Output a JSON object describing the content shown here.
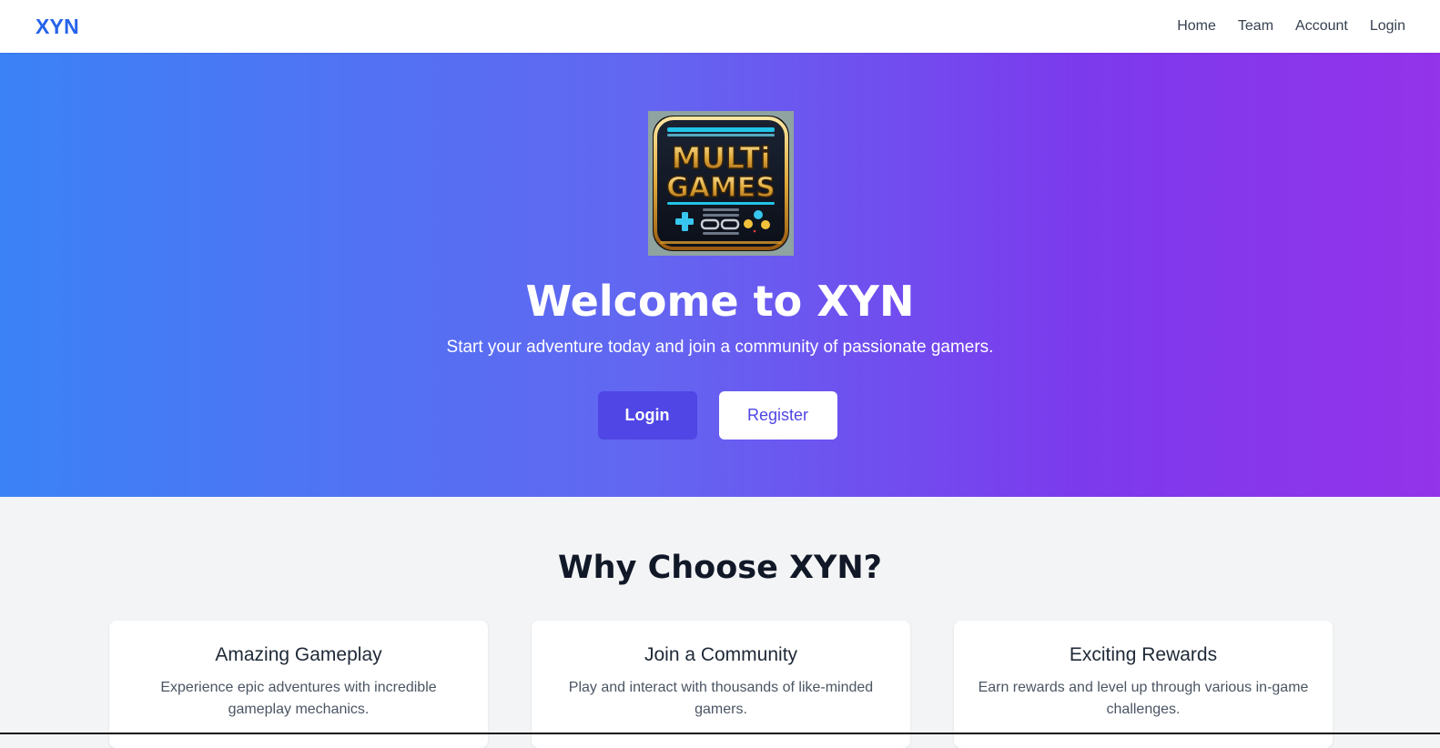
{
  "navbar": {
    "brand": "XYN",
    "links": [
      "Home",
      "Team",
      "Account",
      "Login"
    ]
  },
  "hero": {
    "logo": {
      "line1": "MULTi",
      "line2": "GAMES"
    },
    "title": "Welcome to XYN",
    "subtitle": "Start your adventure today and join a community of passionate gamers.",
    "login_label": "Login",
    "register_label": "Register"
  },
  "features": {
    "title": "Why Choose XYN?",
    "cards": [
      {
        "title": "Amazing Gameplay",
        "text": "Experience epic adventures with incredible gameplay mechanics."
      },
      {
        "title": "Join a Community",
        "text": "Play and interact with thousands of like-minded gamers."
      },
      {
        "title": "Exciting Rewards",
        "text": "Earn rewards and level up through various in-game challenges."
      }
    ]
  },
  "colors": {
    "brand": "#2563eb",
    "primary_button": "#4f46e5",
    "hero_gradient_start": "#3b82f6",
    "hero_gradient_end": "#9333ea"
  }
}
